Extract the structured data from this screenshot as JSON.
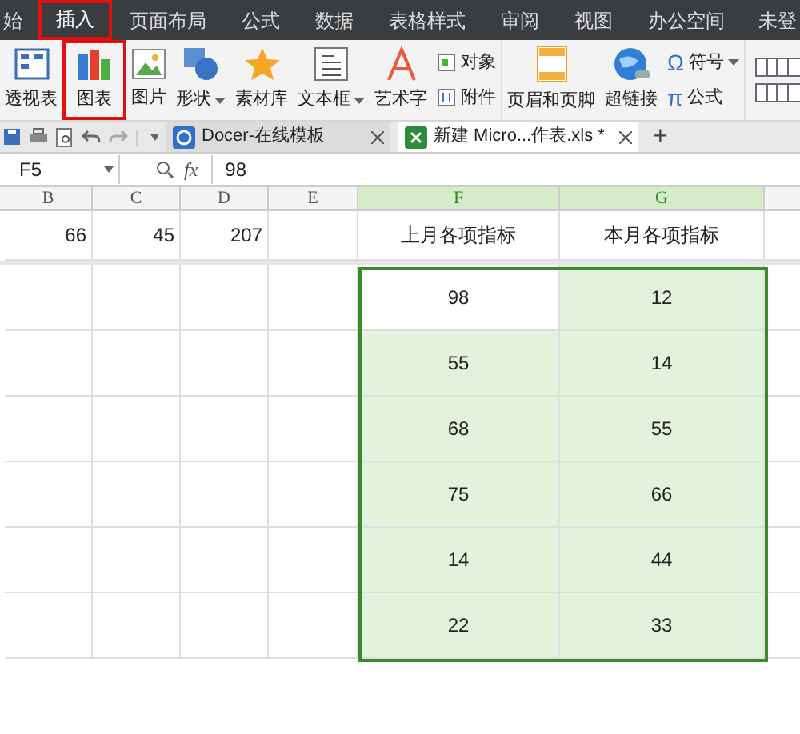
{
  "menu_tabs": [
    {
      "label": "始",
      "selected": false,
      "highlighted": false
    },
    {
      "label": "插入",
      "selected": true,
      "highlighted": true
    },
    {
      "label": "页面布局",
      "selected": false,
      "highlighted": false
    },
    {
      "label": "公式",
      "selected": false,
      "highlighted": false
    },
    {
      "label": "数据",
      "selected": false,
      "highlighted": false
    },
    {
      "label": "表格样式",
      "selected": false,
      "highlighted": false
    },
    {
      "label": "审阅",
      "selected": false,
      "highlighted": false
    },
    {
      "label": "视图",
      "selected": false,
      "highlighted": false
    },
    {
      "label": "办公空间",
      "selected": false,
      "highlighted": false
    }
  ],
  "account": "未登",
  "ribbon": [
    {
      "kind": "large",
      "label": "透视表",
      "highlighted": false
    },
    {
      "kind": "large",
      "label": "图表",
      "highlighted": true
    },
    {
      "kind": "large",
      "label": "图片",
      "highlighted": false
    },
    {
      "kind": "large",
      "label": "形状",
      "dropdown": true,
      "highlighted": false
    },
    {
      "kind": "large",
      "label": "素材库",
      "highlighted": false
    },
    {
      "kind": "large",
      "label": "文本框",
      "dropdown": true,
      "highlighted": false
    },
    {
      "kind": "large",
      "label": "艺术字",
      "highlighted": false
    },
    {
      "kind": "stack",
      "items": [
        {
          "label": "对象"
        },
        {
          "label": "附件"
        }
      ]
    },
    {
      "kind": "large",
      "label": "页眉和页脚",
      "highlighted": false
    },
    {
      "kind": "large",
      "label": "超链接",
      "highlighted": false
    },
    {
      "kind": "stack",
      "items": [
        {
          "glyph": "Ω",
          "label": "符号",
          "dropdown": true
        },
        {
          "glyph": "π",
          "label": "公式"
        }
      ]
    },
    {
      "kind": "grid"
    }
  ],
  "doc_tabs": [
    {
      "label": "Docer-在线模板",
      "selected": false
    },
    {
      "label": "新建 Micro...作表.xls *",
      "selected": true
    }
  ],
  "new_tab": "+",
  "formula_bar": {
    "cell": "F5",
    "fx": "fx",
    "value": "98"
  },
  "sheet": {
    "columns": [
      {
        "label": "B",
        "selected": false
      },
      {
        "label": "C",
        "selected": false
      },
      {
        "label": "D",
        "selected": false
      },
      {
        "label": "E",
        "selected": false
      },
      {
        "label": "F",
        "selected": true
      },
      {
        "label": "G",
        "selected": true
      }
    ],
    "rows": [
      [
        "66",
        "45",
        "207",
        "",
        "上月各项指标",
        "本月各项指标"
      ],
      [
        "",
        "",
        "",
        "",
        "98",
        "12"
      ],
      [
        "",
        "",
        "",
        "",
        "55",
        "14"
      ],
      [
        "",
        "",
        "",
        "",
        "68",
        "55"
      ],
      [
        "",
        "",
        "",
        "",
        "75",
        "66"
      ],
      [
        "",
        "",
        "",
        "",
        "14",
        "44"
      ],
      [
        "",
        "",
        "",
        "",
        "22",
        "33"
      ]
    ]
  }
}
